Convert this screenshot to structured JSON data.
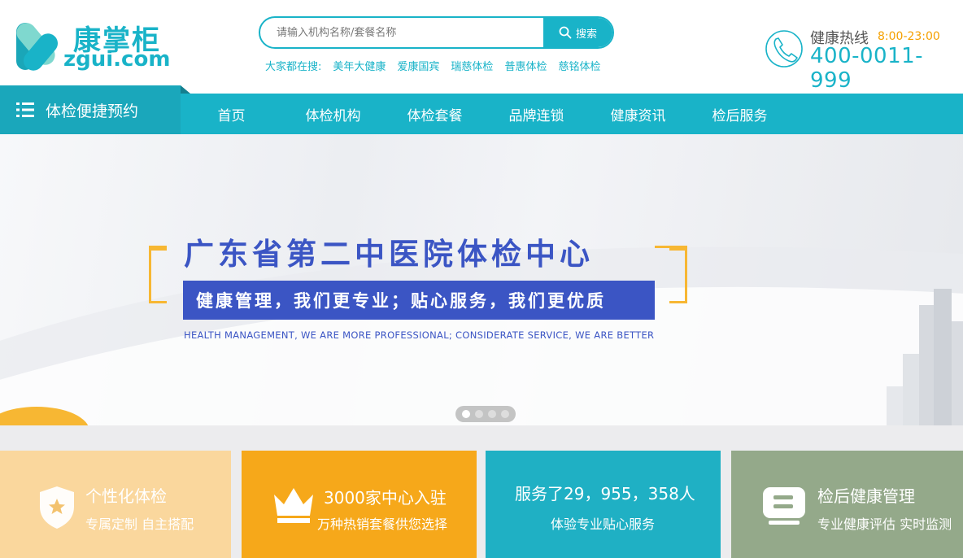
{
  "logo": {
    "cn": "康掌柜",
    "en": "zgui.com"
  },
  "search": {
    "placeholder": "请输入机构名称/套餐名称",
    "button_label": "搜索",
    "hot_label": "大家都在搜:",
    "hot_items": [
      "美年大健康",
      "爱康国宾",
      "瑞慈体检",
      "普惠体检",
      "慈铭体检"
    ]
  },
  "hotline": {
    "label": "健康热线",
    "hours": "8:00-23:00",
    "number": "400-0011-999"
  },
  "nav": {
    "category_label": "体检便捷预约",
    "items": [
      "首页",
      "体检机构",
      "体检套餐",
      "品牌连锁",
      "健康资讯",
      "检后服务"
    ]
  },
  "banner": {
    "title": "广东省第二中医院体检中心",
    "subtitle": "健康管理，我们更专业；贴心服务，我们更优质",
    "english": "HEALTH MANAGEMENT, WE ARE MORE PROFESSIONAL; CONSIDERATE SERVICE, WE ARE BETTER",
    "slide_count": 4,
    "active_slide": 1
  },
  "features": [
    {
      "title": "个性化体检",
      "subtitle": "专属定制  自主搭配",
      "icon": "shield-star-icon",
      "color": "#fad79d"
    },
    {
      "title": "3000家中心入驻",
      "subtitle": "万种热销套餐供您选择",
      "icon": "crown-icon",
      "color": "#f6a81a"
    },
    {
      "title": "服务了29，955，358人",
      "subtitle": "体验专业贴心服务",
      "icon": "",
      "color": "#1fb0c4"
    },
    {
      "title": "检后健康管理",
      "subtitle": "专业健康评估  实时监测",
      "icon": "health-record-icon",
      "color": "#94a98a"
    }
  ],
  "colors": {
    "brand": "#19b3c8",
    "accent": "#f5a000",
    "banner_blue": "#3b55c4"
  }
}
